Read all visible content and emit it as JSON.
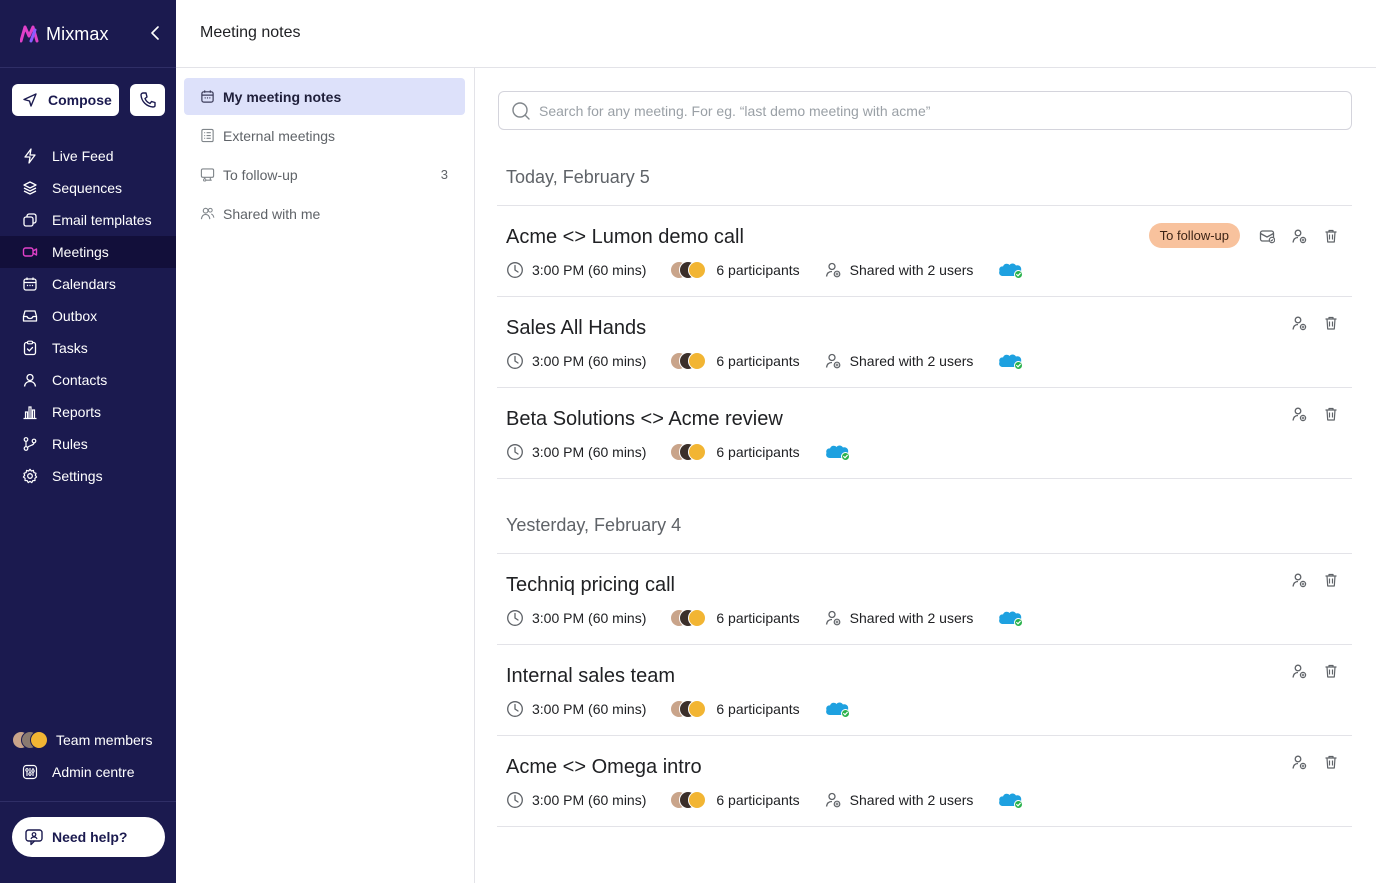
{
  "app": {
    "name": "Mixmax"
  },
  "sidebar": {
    "compose_label": "Compose",
    "items": [
      {
        "label": "Live Feed",
        "icon": "bolt-icon"
      },
      {
        "label": "Sequences",
        "icon": "layers-icon"
      },
      {
        "label": "Email templates",
        "icon": "templates-icon"
      },
      {
        "label": "Meetings",
        "icon": "video-icon",
        "active": true
      },
      {
        "label": "Calendars",
        "icon": "calendar-icon"
      },
      {
        "label": "Outbox",
        "icon": "outbox-icon"
      },
      {
        "label": "Tasks",
        "icon": "clipboard-check-icon"
      },
      {
        "label": "Contacts",
        "icon": "person-icon"
      },
      {
        "label": "Reports",
        "icon": "bar-chart-icon"
      },
      {
        "label": "Rules",
        "icon": "branch-icon"
      },
      {
        "label": "Settings",
        "icon": "gear-icon"
      }
    ],
    "team_members_label": "Team members",
    "admin_label": "Admin centre",
    "help_label": "Need help?"
  },
  "header": {
    "title": "Meeting notes"
  },
  "subnav": {
    "items": [
      {
        "label": "My meeting notes",
        "icon": "calendar-icon",
        "active": true
      },
      {
        "label": "External meetings",
        "icon": "list-icon"
      },
      {
        "label": "To follow-up",
        "icon": "follow-up-icon",
        "count": "3"
      },
      {
        "label": "Shared with me",
        "icon": "people-icon"
      }
    ]
  },
  "search": {
    "placeholder": "Search for any meeting. For eg. “last demo meeting with acme”"
  },
  "groups": [
    {
      "heading": "Today, February 5",
      "meetings": [
        {
          "title": "Acme <> Lumon demo call",
          "time": "3:00 PM (60 mins)",
          "participants": "6 participants",
          "shared": "Shared with 2 users",
          "badge": "To follow-up"
        },
        {
          "title": "Sales All Hands",
          "time": "3:00 PM (60 mins)",
          "participants": "6 participants",
          "shared": "Shared with 2 users"
        },
        {
          "title": "Beta Solutions <> Acme review",
          "time": "3:00 PM (60 mins)",
          "participants": "6 participants"
        }
      ]
    },
    {
      "heading": "Yesterday, February 4",
      "meetings": [
        {
          "title": "Techniq pricing call",
          "time": "3:00 PM (60 mins)",
          "participants": "6 participants",
          "shared": "Shared with 2 users"
        },
        {
          "title": "Internal sales team",
          "time": "3:00 PM (60 mins)",
          "participants": "6 participants"
        },
        {
          "title": "Acme <> Omega intro",
          "time": "3:00 PM (60 mins)",
          "participants": "6 participants",
          "shared": "Shared with 2 users"
        }
      ]
    }
  ],
  "colors": {
    "sidebar_bg": "#1b1a4f",
    "sidebar_active": "#120f3a",
    "subnav_active": "#dde1fa",
    "followup_badge": "#f8c29d",
    "salesforce": "#1ea1e0",
    "check_green": "#2bb24c",
    "brand_pink": "#e040c8"
  }
}
